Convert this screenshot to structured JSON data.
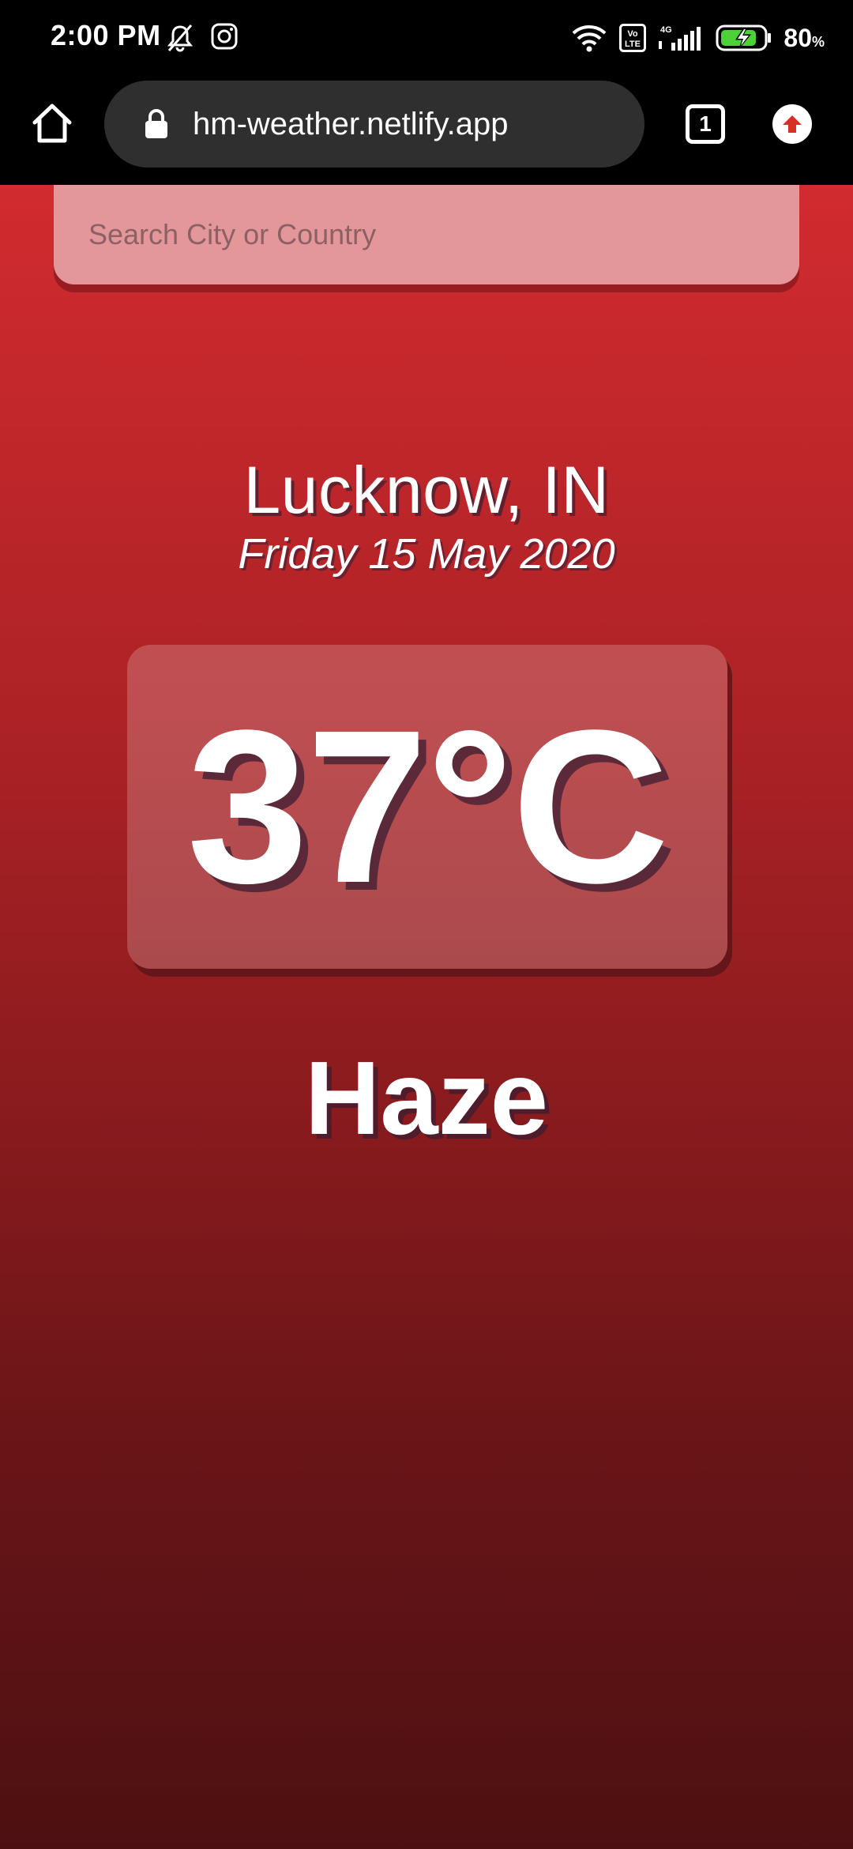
{
  "status_bar": {
    "time": "2:00 PM",
    "icons_left": [
      "mute-icon",
      "instagram-icon"
    ],
    "icons_right": [
      "wifi-icon",
      "volte-icon",
      "signal-4g-icon",
      "battery-charging-icon"
    ],
    "battery_percent": "80",
    "battery_unit": "%",
    "volte_label": "Vo LTE",
    "network_label": "4G",
    "battery_color": "#4cd137"
  },
  "browser": {
    "url": "hm-weather.netlify.app",
    "tab_count": "1",
    "update_icon_color": "#d93025"
  },
  "search": {
    "placeholder": "Search City or Country",
    "value": ""
  },
  "weather": {
    "location": "Lucknow, IN",
    "date": "Friday 15 May 2020",
    "temperature": "37°C",
    "condition": "Haze"
  },
  "theme": {
    "gradient_top": "#d12b2f",
    "gradient_bottom": "#4d1012",
    "search_bg": "#e3979a"
  }
}
